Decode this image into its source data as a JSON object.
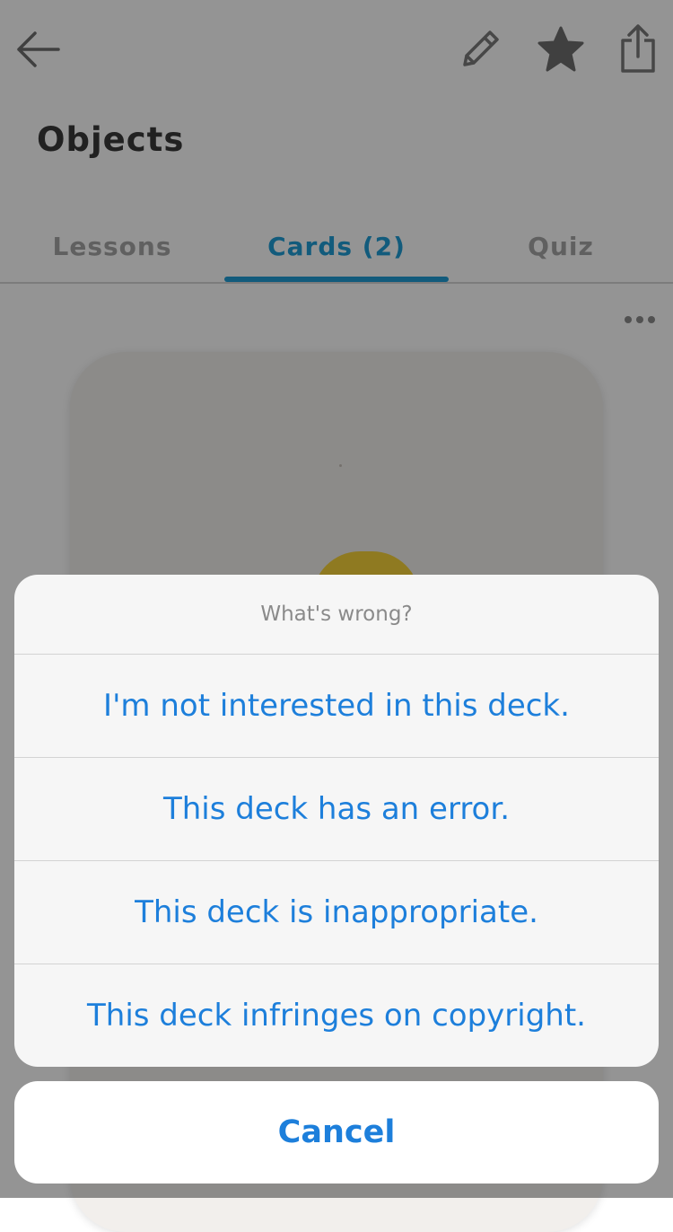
{
  "header": {
    "title": "Objects",
    "icons": {
      "back": "arrow-left-icon",
      "edit": "pencil-icon",
      "favorite": "star-icon",
      "share": "share-icon"
    }
  },
  "tabs": [
    {
      "label": "Lessons",
      "active": false
    },
    {
      "label": "Cards (2)",
      "active": true
    },
    {
      "label": "Quiz",
      "active": false
    }
  ],
  "more_menu": {
    "icon": "more-horizontal-icon"
  },
  "action_sheet": {
    "title": "What's wrong?",
    "options": [
      "I'm not interested in this deck.",
      "This deck has an error.",
      "This deck is inappropriate.",
      "This deck infringes on copyright."
    ],
    "cancel_label": "Cancel"
  },
  "colors": {
    "accent_tab": "#1f9ed6",
    "action_text": "#1d7fdb",
    "overlay": "rgba(0,0,0,0.42)"
  }
}
